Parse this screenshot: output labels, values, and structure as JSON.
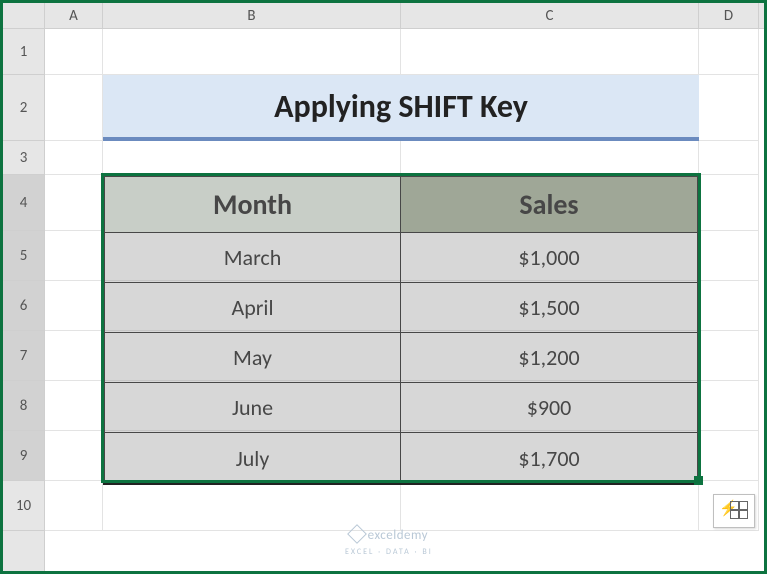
{
  "columns": [
    "A",
    "B",
    "C",
    "D"
  ],
  "rows": [
    "1",
    "2",
    "3",
    "4",
    "5",
    "6",
    "7",
    "8",
    "9",
    "10"
  ],
  "title": "Applying SHIFT Key",
  "table": {
    "headers": {
      "month": "Month",
      "sales": "Sales"
    },
    "rows": [
      {
        "month": "March",
        "sales": "$1,000"
      },
      {
        "month": "April",
        "sales": "$1,500"
      },
      {
        "month": "May",
        "sales": "$1,200"
      },
      {
        "month": "June",
        "sales": "$900"
      },
      {
        "month": "July",
        "sales": "$1,700"
      }
    ]
  },
  "watermark": {
    "brand": "exceldemy",
    "tag": "EXCEL · DATA · BI"
  },
  "icons": {
    "quick_analysis": "quick-analysis-icon"
  }
}
